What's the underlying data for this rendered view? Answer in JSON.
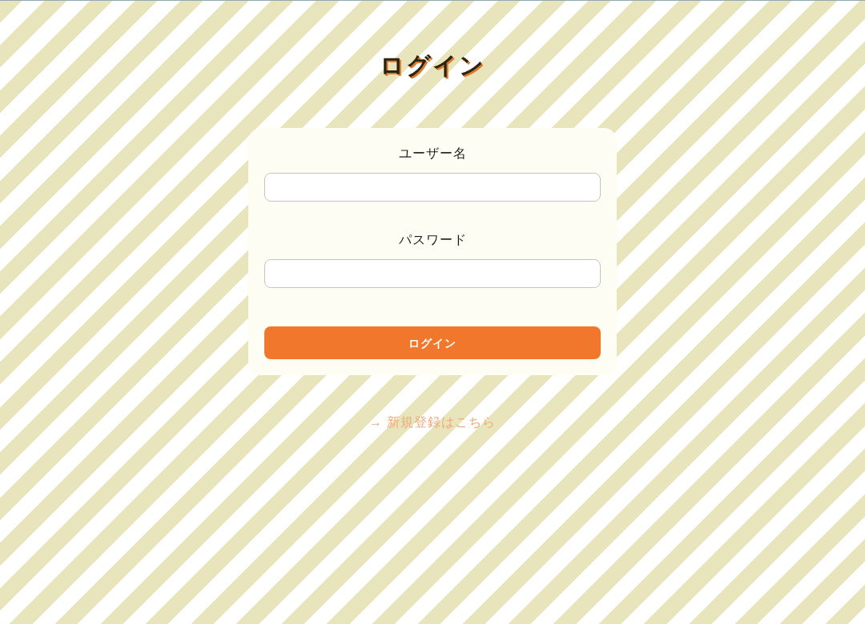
{
  "title": "ログイン",
  "form": {
    "fields": [
      {
        "label": "ユーザー名"
      },
      {
        "label": "パスワード"
      }
    ],
    "submit_button": "ログイン"
  },
  "register_link": "→ 新規登録はこちら"
}
